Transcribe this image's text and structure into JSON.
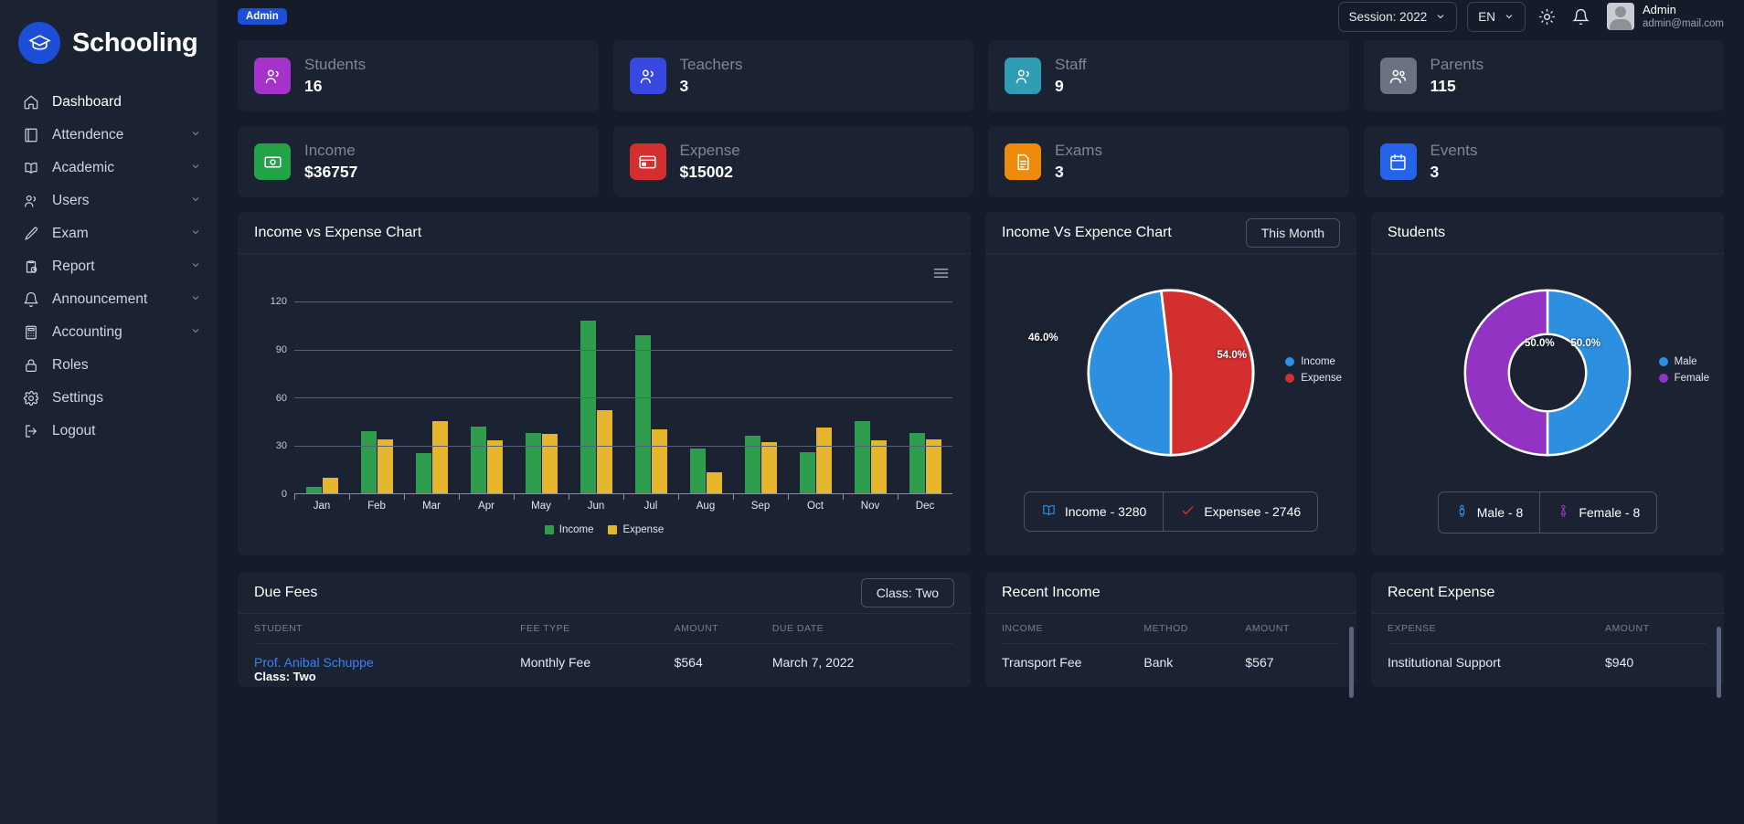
{
  "brand": {
    "name": "Schooling",
    "logo_icon": "graduation-cap-icon"
  },
  "sidebar": {
    "items": [
      {
        "label": "Dashboard",
        "icon": "home-icon",
        "expandable": false,
        "active": true
      },
      {
        "label": "Attendence",
        "icon": "book-icon",
        "expandable": true,
        "active": false
      },
      {
        "label": "Academic",
        "icon": "open-book-icon",
        "expandable": true,
        "active": false
      },
      {
        "label": "Users",
        "icon": "users-icon",
        "expandable": true,
        "active": false
      },
      {
        "label": "Exam",
        "icon": "pencil-icon",
        "expandable": true,
        "active": false
      },
      {
        "label": "Report",
        "icon": "clipboard-clock-icon",
        "expandable": true,
        "active": false
      },
      {
        "label": "Announcement",
        "icon": "bell-icon",
        "expandable": true,
        "active": false
      },
      {
        "label": "Accounting",
        "icon": "calculator-icon",
        "expandable": true,
        "active": false
      },
      {
        "label": "Roles",
        "icon": "lock-icon",
        "expandable": false,
        "active": false
      },
      {
        "label": "Settings",
        "icon": "gear-icon",
        "expandable": false,
        "active": false
      },
      {
        "label": "Logout",
        "icon": "logout-icon",
        "expandable": false,
        "active": false
      }
    ]
  },
  "topbar": {
    "role_badge": "Admin",
    "session": "Session: 2022",
    "language": "EN",
    "theme_icon": "sun-icon",
    "notification_icon": "bell-icon",
    "user": {
      "name": "Admin",
      "email": "admin@mail.com"
    }
  },
  "stats": [
    {
      "label": "Students",
      "value": "16",
      "icon": "users-icon",
      "color": "#a432cb"
    },
    {
      "label": "Teachers",
      "value": "3",
      "icon": "users-icon",
      "color": "#3749e0"
    },
    {
      "label": "Staff",
      "value": "9",
      "icon": "users-icon",
      "color": "#2f9db5"
    },
    {
      "label": "Parents",
      "value": "115",
      "icon": "users-group-icon",
      "color": "#6b7280"
    },
    {
      "label": "Income",
      "value": "$36757",
      "icon": "money-icon",
      "color": "#22a345"
    },
    {
      "label": "Expense",
      "value": "$15002",
      "icon": "card-icon",
      "color": "#d32f2f"
    },
    {
      "label": "Exams",
      "value": "3",
      "icon": "exam-paper-icon",
      "color": "#ef8b0b"
    },
    {
      "label": "Events",
      "value": "3",
      "icon": "calendar-icon",
      "color": "#2563eb"
    }
  ],
  "bar_card": {
    "title": "Income vs Expense Chart",
    "menu_icon": "hamburger-menu-icon"
  },
  "pie_card": {
    "title": "Income Vs Expence Chart",
    "filter_label": "This Month",
    "footer": [
      {
        "label": "Income - 3280",
        "icon": "book-icon",
        "color": "#2d8fe0"
      },
      {
        "label": "Expensee - 2746",
        "icon": "check-icon",
        "color": "#d32f2f"
      }
    ]
  },
  "students_card": {
    "title": "Students",
    "footer": [
      {
        "label": "Male - 8",
        "icon": "male-person-icon",
        "color": "#2d8fe0"
      },
      {
        "label": "Female - 8",
        "icon": "female-person-icon",
        "color": "#9333c4"
      }
    ]
  },
  "due_fees": {
    "title": "Due Fees",
    "filter_label": "Class: Two",
    "columns": [
      "STUDENT",
      "FEE TYPE",
      "AMOUNT",
      "DUE DATE"
    ],
    "rows": [
      {
        "student": "Prof. Anibal Schuppe",
        "student_sub": "Class: Two",
        "fee_type": "Monthly Fee",
        "amount": "$564",
        "due_date": "March 7, 2022"
      }
    ]
  },
  "recent_income": {
    "title": "Recent Income",
    "columns": [
      "INCOME",
      "METHOD",
      "AMOUNT"
    ],
    "rows": [
      {
        "income": "Transport Fee",
        "method": "Bank",
        "amount": "$567"
      }
    ]
  },
  "recent_expense": {
    "title": "Recent Expense",
    "columns": [
      "EXPENSE",
      "AMOUNT"
    ],
    "rows": [
      {
        "expense": "Institutional Support",
        "amount": "$940"
      }
    ]
  },
  "chart_data": [
    {
      "type": "bar",
      "title": "Income vs Expense Chart",
      "categories": [
        "Jan",
        "Feb",
        "Mar",
        "Apr",
        "May",
        "Jun",
        "Jul",
        "Aug",
        "Sep",
        "Oct",
        "Nov",
        "Dec"
      ],
      "series": [
        {
          "name": "Income",
          "color": "#2e9e4e",
          "values": [
            4,
            39,
            25,
            42,
            38,
            108,
            99,
            28,
            36,
            26,
            45,
            38
          ]
        },
        {
          "name": "Expense",
          "color": "#e5b52b",
          "values": [
            10,
            34,
            45,
            33,
            37,
            52,
            40,
            13,
            32,
            41,
            33,
            34
          ]
        }
      ],
      "ylabel": "",
      "xlabel": "",
      "yticks": [
        0,
        30,
        60,
        90,
        120
      ],
      "ylim": [
        0,
        128
      ],
      "grid": true,
      "legend_position": "bottom"
    },
    {
      "type": "pie",
      "title": "Income Vs Expence Chart",
      "labels": [
        "Income",
        "Expense"
      ],
      "values": [
        54.0,
        46.0
      ],
      "value_labels": [
        "54.0%",
        "46.0%"
      ],
      "colors": [
        "#2d8fe0",
        "#d32f2f"
      ],
      "legend_position": "right"
    },
    {
      "type": "pie",
      "title": "Students",
      "donut": true,
      "labels": [
        "Male",
        "Female"
      ],
      "values": [
        50.0,
        50.0
      ],
      "value_labels": [
        "50.0%",
        "50.0%"
      ],
      "colors": [
        "#2d8fe0",
        "#9333c4"
      ],
      "legend_position": "right"
    }
  ]
}
